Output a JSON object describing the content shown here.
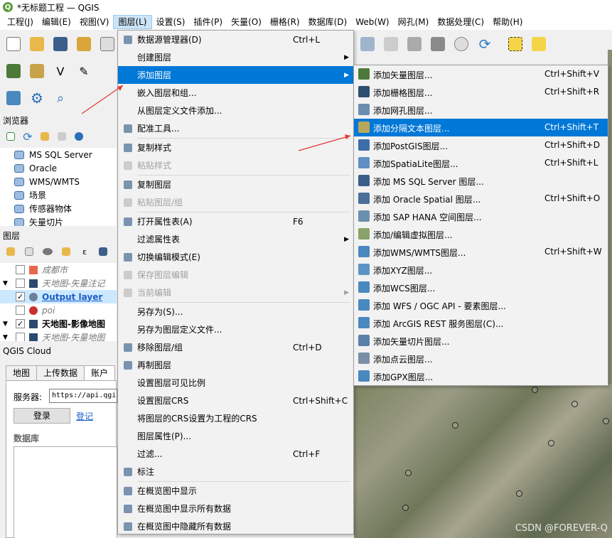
{
  "window": {
    "title": "*无标题工程 — QGIS",
    "app_icon_letter": "Q"
  },
  "menubar": [
    {
      "label": "工程(J)"
    },
    {
      "label": "编辑(E)"
    },
    {
      "label": "视图(V)"
    },
    {
      "label": "图层(L)"
    },
    {
      "label": "设置(S)"
    },
    {
      "label": "插件(P)"
    },
    {
      "label": "矢量(O)"
    },
    {
      "label": "栅格(R)"
    },
    {
      "label": "数据库(D)"
    },
    {
      "label": "Web(W)"
    },
    {
      "label": "网孔(M)"
    },
    {
      "label": "数据处理(C)"
    },
    {
      "label": "帮助(H)"
    }
  ],
  "browser": {
    "title": "浏览器",
    "items": [
      "MS SQL Server",
      "Oracle",
      "WMS/WMTS",
      "场景",
      "传感器物体",
      "矢量切片"
    ]
  },
  "layers": {
    "title": "图层",
    "items": [
      {
        "label": "成都市",
        "checked": "",
        "style": "italic",
        "color": "#e8674a"
      },
      {
        "label": "天地图-矢量注记",
        "checked": "",
        "style": "italic",
        "color": "#2c4a6e"
      },
      {
        "label": "Output layer",
        "checked": "✓",
        "style": "link",
        "color": "#6a7f9a"
      },
      {
        "label": "poi",
        "checked": "",
        "style": "italic",
        "color": "#c9302c"
      },
      {
        "label": "天地图-影像地图",
        "checked": "✓",
        "style": "bold",
        "color": "#2c4a6e"
      },
      {
        "label": "天地图-矢量地图",
        "checked": "",
        "style": "italic",
        "color": "#2c4a6e"
      }
    ]
  },
  "cloud": {
    "title": "QGIS Cloud",
    "tabs": [
      "地图",
      "上传数据",
      "账户"
    ],
    "server_label": "服务器:",
    "server_value": "https://api.qgiscloud.com",
    "login": "登录",
    "register": "登记",
    "db_label": "数据库"
  },
  "layer_menu": [
    {
      "label": "数据源管理器(D)",
      "shortcut": "Ctrl+L",
      "icon": "datasource-icon"
    },
    {
      "label": "创建图层",
      "shortcut": "",
      "submenu": true
    },
    {
      "label": "添加图层",
      "shortcut": "",
      "submenu": true,
      "highlight": true
    },
    {
      "label": "嵌入图层和组...",
      "shortcut": ""
    },
    {
      "label": "从图层定义文件添加...",
      "shortcut": ""
    },
    {
      "label": "配准工具...",
      "shortcut": "",
      "icon": "georef-icon"
    },
    {
      "sep": true
    },
    {
      "label": "复制样式",
      "shortcut": "",
      "icon": "copy-style-icon"
    },
    {
      "label": "粘贴样式",
      "shortcut": "",
      "disabled": true,
      "icon": "paste-style-icon"
    },
    {
      "sep": true
    },
    {
      "label": "复制图层",
      "shortcut": "",
      "icon": "copy-layer-icon"
    },
    {
      "label": "粘贴图层/组",
      "shortcut": "",
      "disabled": true,
      "icon": "paste-layer-icon"
    },
    {
      "sep": true
    },
    {
      "label": "打开属性表(A)",
      "shortcut": "F6",
      "icon": "table-icon"
    },
    {
      "label": "过滤属性表",
      "shortcut": "",
      "submenu": true
    },
    {
      "label": "切换编辑模式(E)",
      "shortcut": "",
      "icon": "pencil-icon"
    },
    {
      "label": "保存图层编辑",
      "shortcut": "",
      "disabled": true,
      "icon": "save-edit-icon"
    },
    {
      "label": "当前编辑",
      "shortcut": "",
      "disabled": true,
      "submenu": true,
      "icon": "current-edit-icon"
    },
    {
      "sep": true
    },
    {
      "label": "另存为(S)...",
      "shortcut": ""
    },
    {
      "label": "另存为图层定义文件...",
      "shortcut": ""
    },
    {
      "label": "移除图层/组",
      "shortcut": "Ctrl+D",
      "icon": "remove-layer-icon"
    },
    {
      "label": "再制图层",
      "shortcut": "",
      "icon": "duplicate-layer-icon"
    },
    {
      "label": "设置图层可见比例",
      "shortcut": ""
    },
    {
      "label": "设置图层CRS",
      "shortcut": "Ctrl+Shift+C"
    },
    {
      "label": "将图层的CRS设置为工程的CRS",
      "shortcut": ""
    },
    {
      "label": "图层属性(P)...",
      "shortcut": ""
    },
    {
      "label": "过滤...",
      "shortcut": "Ctrl+F"
    },
    {
      "label": "标注",
      "shortcut": "",
      "icon": "label-icon"
    },
    {
      "sep": true
    },
    {
      "label": "在概览图中显示",
      "shortcut": "",
      "icon": "overview-show-icon"
    },
    {
      "label": "在概览图中显示所有数据",
      "shortcut": "",
      "icon": "overview-all-icon"
    },
    {
      "label": "在概览图中隐藏所有数据",
      "shortcut": "",
      "icon": "overview-hide-icon"
    }
  ],
  "add_layer_menu": [
    {
      "label": "添加矢量图层...",
      "shortcut": "Ctrl+Shift+V",
      "color": "#4d7a3a"
    },
    {
      "label": "添加栅格图层...",
      "shortcut": "Ctrl+Shift+R",
      "color": "#2f4f6f"
    },
    {
      "label": "添加网孔图层...",
      "shortcut": "",
      "color": "#6a8caf"
    },
    {
      "label": "添加分隔文本图层...",
      "shortcut": "Ctrl+Shift+T",
      "color": "#b8a75a",
      "highlight": true
    },
    {
      "label": "添加PostGIS图层...",
      "shortcut": "Ctrl+Shift+D",
      "color": "#3b6ea8"
    },
    {
      "label": "添加SpatiaLite图层...",
      "shortcut": "Ctrl+Shift+L",
      "color": "#5f8fc4"
    },
    {
      "label": "添加 MS SQL Server 图层...",
      "shortcut": "",
      "color": "#3b5f8a"
    },
    {
      "label": "添加 Oracle Spatial 图层...",
      "shortcut": "Ctrl+Shift+O",
      "color": "#4a6f99"
    },
    {
      "label": "添加 SAP HANA 空间图层...",
      "shortcut": "",
      "color": "#6c8fb0"
    },
    {
      "label": "添加/编辑虚拟图层...",
      "shortcut": "",
      "color": "#8aa36a"
    },
    {
      "label": "添加WMS/WMTS图层...",
      "shortcut": "Ctrl+Shift+W",
      "color": "#4a88c0"
    },
    {
      "label": "添加XYZ图层...",
      "shortcut": "",
      "color": "#5c93c7"
    },
    {
      "label": "添加WCS图层...",
      "shortcut": "",
      "color": "#4a88c0"
    },
    {
      "label": "添加 WFS / OGC API - 要素图层...",
      "shortcut": "",
      "color": "#4a88c0"
    },
    {
      "label": "添加 ArcGIS REST 服务图层(C)...",
      "shortcut": "",
      "color": "#4a88c0"
    },
    {
      "label": "添加矢量切片图层...",
      "shortcut": "",
      "color": "#5a7fa8"
    },
    {
      "label": "添加点云图层...",
      "shortcut": "",
      "color": "#7a8fa5"
    },
    {
      "label": "添加GPX图层...",
      "shortcut": "",
      "color": "#4a88c0"
    }
  ],
  "watermark": "CSDN @FOREVER-Q"
}
